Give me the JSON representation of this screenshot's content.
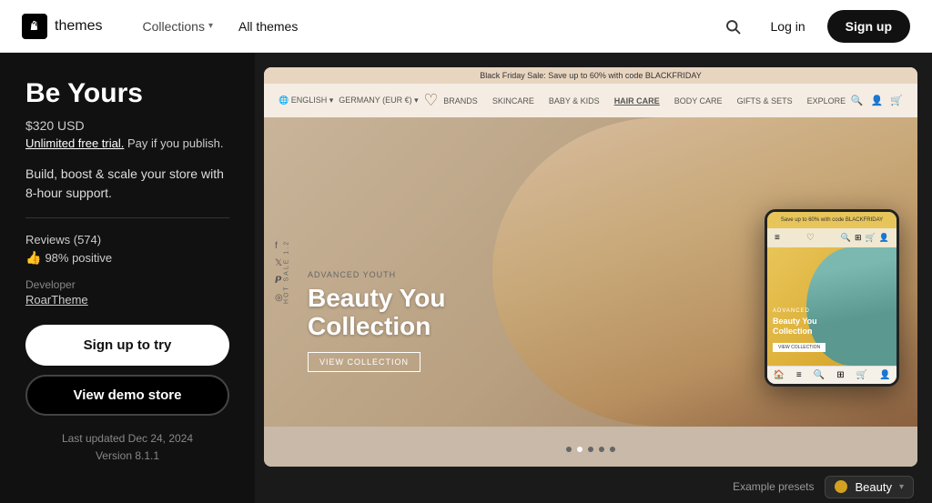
{
  "navbar": {
    "logo_text": "themes",
    "nav_items": [
      {
        "label": "Collections",
        "has_dropdown": true
      },
      {
        "label": "All themes",
        "has_dropdown": false
      }
    ],
    "login_label": "Log in",
    "signup_label": "Sign up"
  },
  "left_panel": {
    "title": "Be Yours",
    "price": "$320 USD",
    "trial_text": "Unlimited free trial.",
    "trial_suffix": " Pay if you publish.",
    "description": "Build, boost & scale your store with 8-hour support.",
    "reviews_label": "Reviews (574)",
    "reviews_positive": "98% positive",
    "developer_label": "Developer",
    "developer_name": "RoarTheme",
    "btn_signup": "Sign up to try",
    "btn_demo": "View demo store",
    "last_updated": "Last updated Dec 24, 2024",
    "version": "Version 8.1.1"
  },
  "preview": {
    "store_topbar": "Black Friday Sale: Save up to 60% with code BLACKFRIDAY",
    "nav_links": [
      "BRANDS",
      "SKINCARE",
      "BABY & KIDS",
      "HAIR CARE",
      "BODY CARE",
      "GIFTS & SETS",
      "EXPLORE"
    ],
    "hero_subtitle": "ADVANCED YOUTH",
    "hero_title": "Beauty You Collection",
    "hero_cta": "VIEW COLLECTION",
    "mobile_title": "Beauty You Collection",
    "mobile_cta": "VIEW COLLECTION"
  },
  "bottom_bar": {
    "presets_label": "Example presets",
    "preset_name": "Beauty",
    "preset_color": "#d4a020"
  }
}
